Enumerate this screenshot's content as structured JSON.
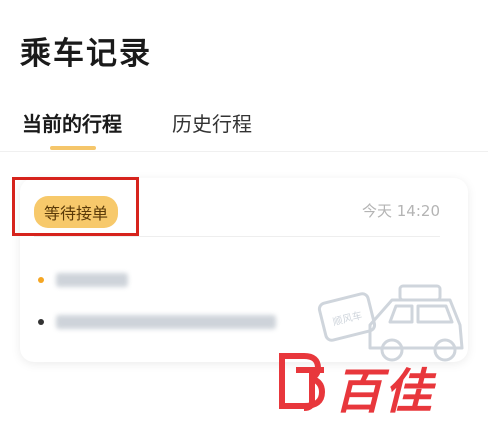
{
  "header": {
    "title": "乘车记录"
  },
  "tabs": [
    {
      "label": "当前的行程",
      "active": true
    },
    {
      "label": "历史行程",
      "active": false
    }
  ],
  "trip_card": {
    "status_badge": "等待接单",
    "time": "今天 14:20",
    "start_dot_color": "#f5a623",
    "end_dot_color": "#333333"
  },
  "watermark": {
    "text": "百佳",
    "color": "#e8373c"
  },
  "colors": {
    "accent": "#f5c66b",
    "highlight": "#d6231c"
  }
}
